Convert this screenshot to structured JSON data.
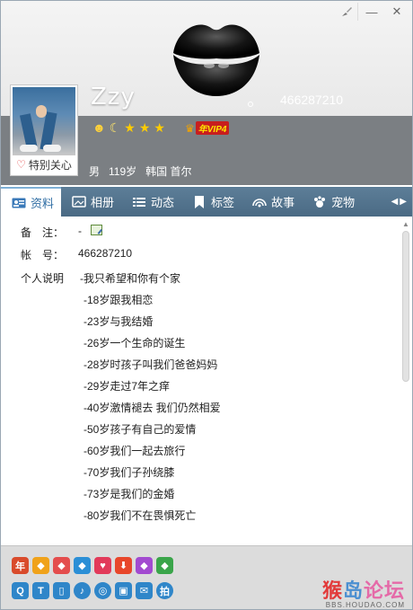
{
  "window": {
    "buttons": {
      "skin_icon": "paintbrush-icon",
      "minimize_label": "—",
      "close_label": "✕"
    }
  },
  "profile": {
    "nickname": "Zzy",
    "qq_number": "466287210",
    "special_care": "特别关心",
    "gender": "男",
    "age": "119岁",
    "location": "韩国 首尔",
    "vip_label": "VIP4",
    "vip_prefix": "年"
  },
  "tabs": [
    {
      "label": "资料",
      "icon": "profile-card-icon",
      "active": true
    },
    {
      "label": "相册",
      "icon": "photo-album-icon",
      "active": false
    },
    {
      "label": "动态",
      "icon": "feed-list-icon",
      "active": false
    },
    {
      "label": "标签",
      "icon": "bookmark-icon",
      "active": false
    },
    {
      "label": "故事",
      "icon": "signal-icon",
      "active": false
    },
    {
      "label": "宠物",
      "icon": "pet-icon",
      "active": false
    }
  ],
  "details": {
    "remark_label": "备　注：",
    "remark_value": "-",
    "account_label": "帐　号：",
    "account_value": "466287210",
    "desc_label": "个人说明",
    "desc_lines": [
      "-我只希望和你有个家",
      "-18岁跟我相恋",
      "-23岁与我结婚",
      "-26岁一个生命的诞生",
      "-28岁时孩子叫我们爸爸妈妈",
      "-29岁走过7年之痒",
      "-40岁激情褪去 我们仍然相爱",
      "-50岁孩子有自己的爱情",
      "-60岁我们一起去旅行",
      "-70岁我们子孙绕膝",
      "-73岁是我们的金婚",
      "-80岁我们不在畏惧死亡"
    ]
  },
  "watermark": {
    "text_a": "猴",
    "text_b": "岛",
    "text_c": "论坛",
    "url": "BBS.HOUDAO.COM"
  },
  "colors": {
    "tab_bar": "#4f7089",
    "cover_band": "#7b7f83",
    "accent": "#2f6ea4",
    "bottom_bg": "#dcdcdc"
  }
}
